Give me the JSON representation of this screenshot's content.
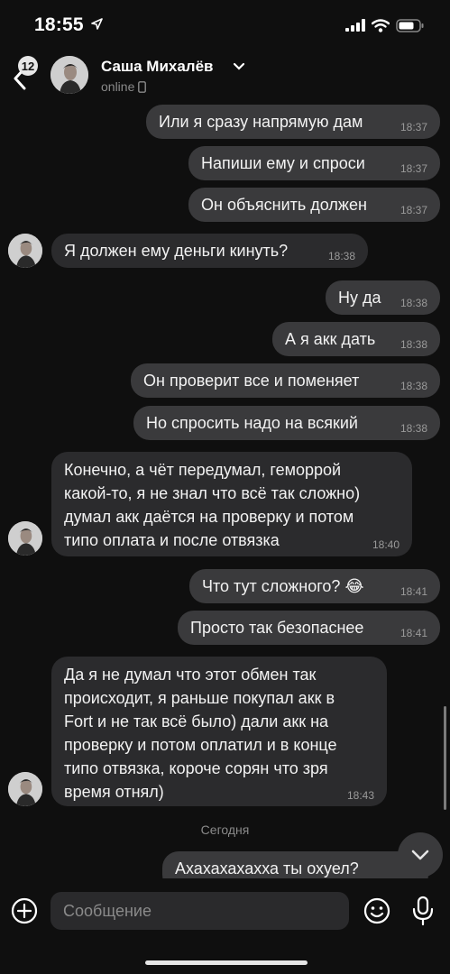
{
  "status_bar": {
    "time": "18:55"
  },
  "header": {
    "unread_count": "12",
    "contact_name": "Саша Михалёв",
    "presence": "online"
  },
  "messages": [
    {
      "dir": "out",
      "text": "Или я сразу напрямую дам",
      "time": "18:37"
    },
    {
      "dir": "out",
      "text": "Напиши ему и спроси",
      "time": "18:37"
    },
    {
      "dir": "out",
      "text": "Он объяснить должен",
      "time": "18:37"
    },
    {
      "dir": "in",
      "text": "Я должен ему деньги кинуть?",
      "time": "18:38"
    },
    {
      "dir": "out",
      "text": "Ну да",
      "time": "18:38"
    },
    {
      "dir": "out",
      "text": "А я акк дать",
      "time": "18:38"
    },
    {
      "dir": "out",
      "text": "Он проверит все и поменяет",
      "time": "18:38"
    },
    {
      "dir": "out",
      "text": "Но спросить надо на всякий",
      "time": "18:38"
    },
    {
      "dir": "in",
      "lines": [
        "Конечно, а чёт передумал, геморрой",
        "какой-то, я не знал что всё так сложно)",
        "думал акк даётся на проверку и потом",
        "типо оплата и после отвязка"
      ],
      "time": "18:40"
    },
    {
      "dir": "out",
      "text": "Что тут сложного? 😂",
      "time": "18:41"
    },
    {
      "dir": "out",
      "text": "Просто так безопаснее",
      "time": "18:41"
    },
    {
      "dir": "in",
      "lines": [
        "Да я не думал что этот обмен так",
        "происходит, я раньше покупал акк в",
        "Fort и не так всё было) дали акк на",
        "проверку и потом оплатил и в конце",
        "типо отвязка, короче сорян что зря",
        "время отнял)"
      ],
      "time": "18:43"
    },
    {
      "dir": "out",
      "text": "Ахахахахахха ты охуел?"
    }
  ],
  "day_separator": "Сегодня",
  "composer": {
    "placeholder": "Сообщение"
  }
}
